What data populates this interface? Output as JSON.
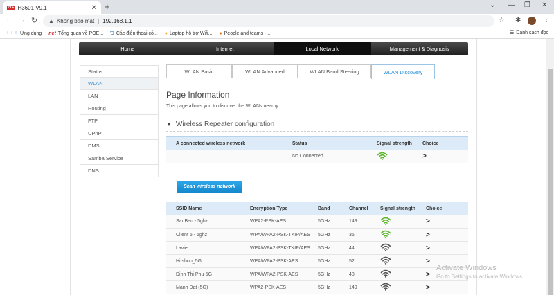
{
  "browser": {
    "tab_title": "H3601 V9.1",
    "tab_favicon": "ZTE",
    "new_tab": "+",
    "security_label": "Không bảo mật",
    "url": "192.168.1.1",
    "bookmarks": [
      {
        "icon": "apps-grid-icon",
        "glyph": "⋮⋮⋮",
        "label": "Ứng dụng"
      },
      {
        "icon": "net-logo-icon",
        "glyph": "net",
        "label": "Tổng quan về POE..."
      },
      {
        "icon": "dt-logo-icon",
        "glyph": "Ɗ",
        "label": "Các điện thoại có..."
      },
      {
        "icon": "laptop-logo-icon",
        "glyph": "●",
        "label": "Laptop hỗ trợ Wifi..."
      },
      {
        "icon": "people-logo-icon",
        "glyph": "●",
        "label": "People and teams -..."
      }
    ],
    "reading_list_label": "Danh sách đọc"
  },
  "nav": {
    "items": [
      "Home",
      "Internet",
      "Local Network",
      "Management & Diagnosis"
    ],
    "active_index": 2
  },
  "sidebar": {
    "items": [
      "Status",
      "WLAN",
      "LAN",
      "Routing",
      "FTP",
      "UPnP",
      "DMS",
      "Samba Service",
      "DNS"
    ],
    "active_index": 1
  },
  "subtabs": {
    "items": [
      "WLAN Basic",
      "WLAN Advanced",
      "WLAN Band Steering",
      "WLAN Discovery"
    ],
    "active_index": 3
  },
  "content": {
    "title": "Page Information",
    "description": "This page allows you to discover the WLANs nearby.",
    "section_title": "Wireless Repeater configuration"
  },
  "repeater_table": {
    "headers": [
      "A connected wireless network",
      "Status",
      "Signal strength",
      "Choice"
    ],
    "row": {
      "network": "",
      "status": "No Connected",
      "signal_level": 4,
      "signal_color": "#5cb82e"
    }
  },
  "scan_button_label": "Scan wireless network",
  "wlan_table": {
    "headers": [
      "SSID Name",
      "Encryption Type",
      "Band",
      "Channel",
      "Signal strength",
      "Choice"
    ],
    "rows": [
      {
        "ssid": "SanBen - 5ghz",
        "enc": "WPA2-PSK-AES",
        "band": "5GHz",
        "channel": "149",
        "signal_level": 4,
        "signal_color": "#5cb82e"
      },
      {
        "ssid": "Client 5 - 5ghz",
        "enc": "WPA/WPA2-PSK-TKIP/AES",
        "band": "5GHz",
        "channel": "36",
        "signal_level": 4,
        "signal_color": "#5cb82e"
      },
      {
        "ssid": "Lavie",
        "enc": "WPA/WPA2-PSK-TKIP/AES",
        "band": "5GHz",
        "channel": "44",
        "signal_level": 4,
        "signal_color": "#555555"
      },
      {
        "ssid": "Hi shop_5G",
        "enc": "WPA/WPA2-PSK-AES",
        "band": "5GHz",
        "channel": "52",
        "signal_level": 4,
        "signal_color": "#555555"
      },
      {
        "ssid": "Dinh Thi Phu-5G",
        "enc": "WPA/WPA2-PSK-AES",
        "band": "5GHz",
        "channel": "48",
        "signal_level": 4,
        "signal_color": "#555555"
      },
      {
        "ssid": "Manh Dat (5G)",
        "enc": "WPA2-PSK-AES",
        "band": "5GHz",
        "channel": "149",
        "signal_level": 4,
        "signal_color": "#555555"
      }
    ]
  },
  "watermark": {
    "line1": "Activate Windows",
    "line2": "Go to Settings to activate Windows."
  }
}
